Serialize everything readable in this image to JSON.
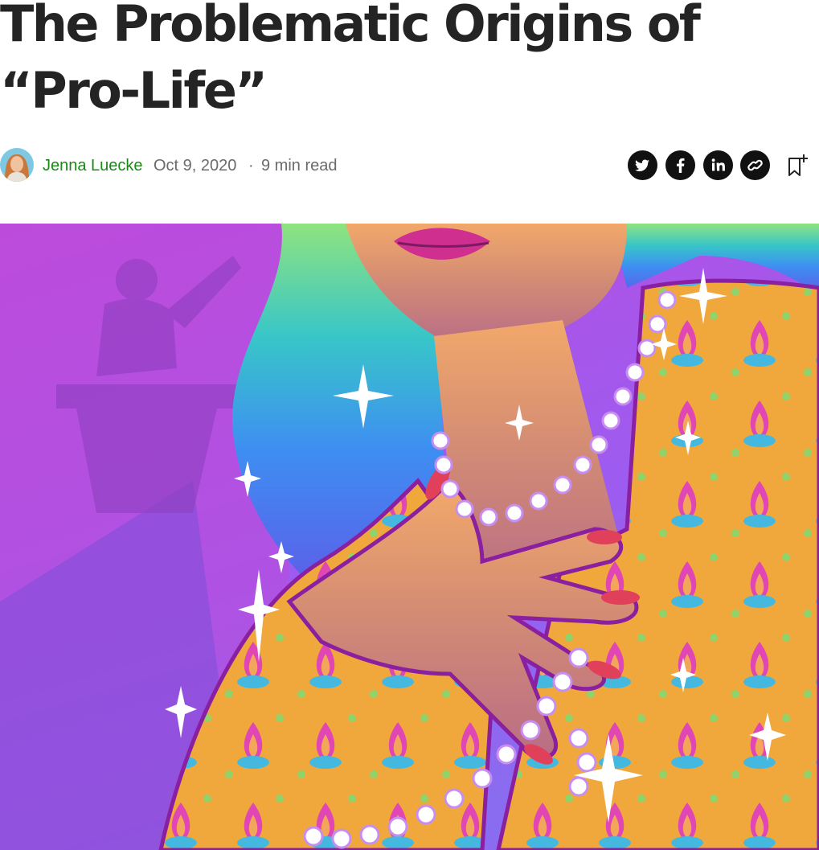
{
  "article": {
    "title": "The Problematic Origins of “Pro-Life”",
    "author": "Jenna Luecke",
    "date": "Oct 9, 2020",
    "separator": "·",
    "read_time": "9 min read"
  },
  "icons": {
    "avatar": "author-avatar",
    "share": [
      "twitter-icon",
      "facebook-icon",
      "linkedin-icon",
      "link-icon"
    ],
    "save": "bookmark-add-icon"
  },
  "colors": {
    "author_link": "#1a8917",
    "meta_text": "#6b6b6b",
    "title_text": "#242424",
    "share_button": "#111111"
  }
}
